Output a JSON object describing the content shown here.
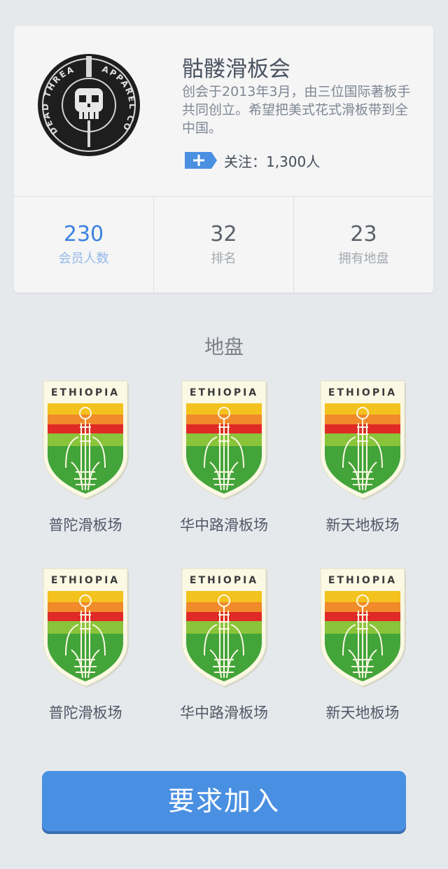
{
  "club": {
    "name": "骷髅滑板会",
    "description": "创会于2013年3月，由三位国际著板手共同创立。希望把美式花式滑板带到全中国。",
    "follow_text": "关注：1,300人",
    "logo_text_left": "DEAD THREADS",
    "logo_text_right": "APPAREL CORP",
    "colors": {
      "follow_button": "#4a90e2",
      "accent": "#3a82e0"
    }
  },
  "stats": [
    {
      "value": "230",
      "label": "会员人数"
    },
    {
      "value": "32",
      "label": "排名"
    },
    {
      "value": "23",
      "label": "拥有地盘"
    }
  ],
  "territory": {
    "title": "地盘",
    "badge_text": "ETHIOPIA",
    "spots": [
      {
        "label": "普陀滑板场"
      },
      {
        "label": "华中路滑板场"
      },
      {
        "label": "新天地板场"
      },
      {
        "label": "普陀滑板场"
      },
      {
        "label": "华中路滑板场"
      },
      {
        "label": "新天地板场"
      }
    ]
  },
  "join_button": {
    "label": "要求加入"
  }
}
